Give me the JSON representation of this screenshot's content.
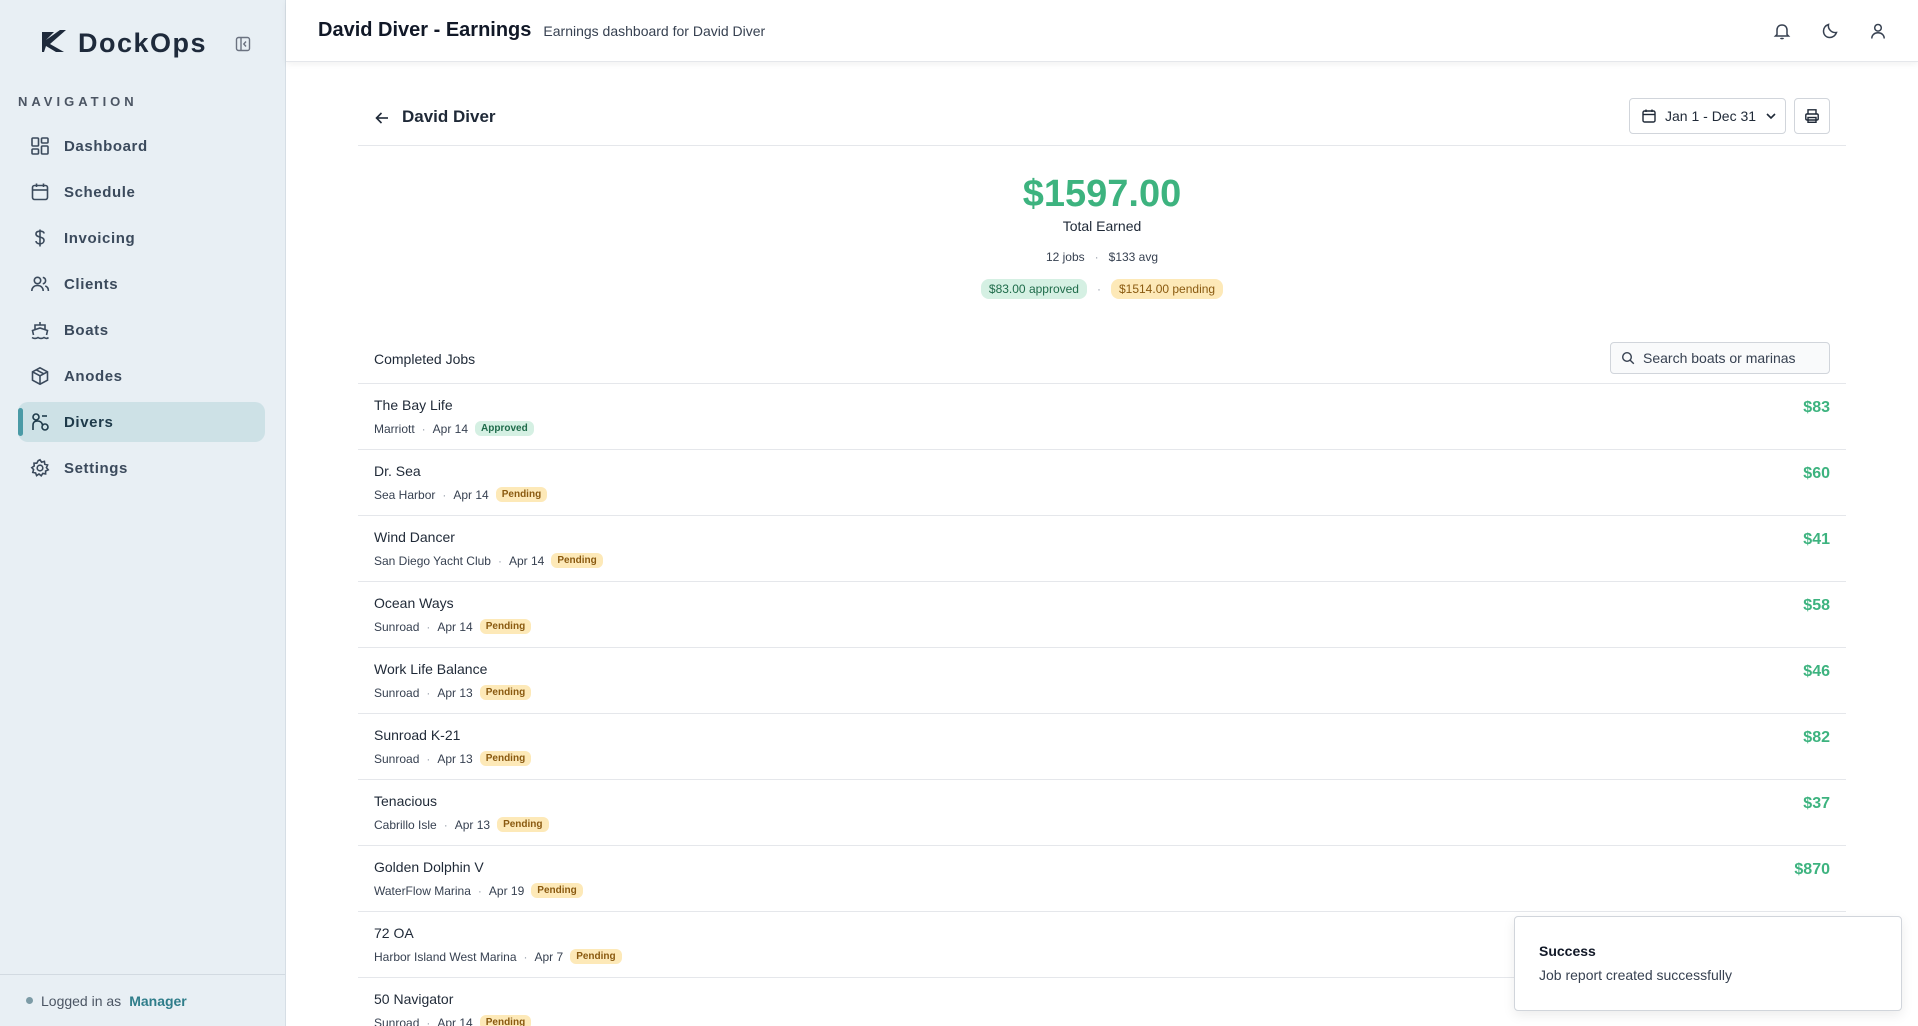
{
  "app": {
    "name": "DockOps"
  },
  "sidebar": {
    "heading": "NAVIGATION",
    "items": [
      {
        "label": "Dashboard",
        "icon": "dashboard-icon",
        "active": false
      },
      {
        "label": "Schedule",
        "icon": "calendar-icon",
        "active": false
      },
      {
        "label": "Invoicing",
        "icon": "dollar-icon",
        "active": false
      },
      {
        "label": "Clients",
        "icon": "users-icon",
        "active": false
      },
      {
        "label": "Boats",
        "icon": "ship-icon",
        "active": false
      },
      {
        "label": "Anodes",
        "icon": "package-icon",
        "active": false
      },
      {
        "label": "Divers",
        "icon": "diver-icon",
        "active": true
      },
      {
        "label": "Settings",
        "icon": "gear-icon",
        "active": false
      }
    ],
    "footer": {
      "prefix": "Logged in as",
      "role": "Manager"
    }
  },
  "header": {
    "title": "David Diver - Earnings",
    "subtitle": "Earnings dashboard for David Diver"
  },
  "page": {
    "diver_name": "David Diver",
    "date_range": "Jan 1 - Dec 31"
  },
  "summary": {
    "total": "$1597.00",
    "total_label": "Total Earned",
    "jobs": "12 jobs",
    "avg": "$133 avg",
    "approved": "$83.00 approved",
    "pending": "$1514.00 pending"
  },
  "jobs_section": {
    "title": "Completed Jobs",
    "search_placeholder": "Search boats or marinas"
  },
  "jobs": [
    {
      "boat": "The Bay Life",
      "marina": "Marriott",
      "date": "Apr 14",
      "status": "Approved",
      "amount": "$83"
    },
    {
      "boat": "Dr. Sea",
      "marina": "Sea Harbor",
      "date": "Apr 14",
      "status": "Pending",
      "amount": "$60"
    },
    {
      "boat": "Wind Dancer",
      "marina": "San Diego Yacht Club",
      "date": "Apr 14",
      "status": "Pending",
      "amount": "$41"
    },
    {
      "boat": "Ocean Ways",
      "marina": "Sunroad",
      "date": "Apr 14",
      "status": "Pending",
      "amount": "$58"
    },
    {
      "boat": "Work Life Balance",
      "marina": "Sunroad",
      "date": "Apr 13",
      "status": "Pending",
      "amount": "$46"
    },
    {
      "boat": "Sunroad K-21",
      "marina": "Sunroad",
      "date": "Apr 13",
      "status": "Pending",
      "amount": "$82"
    },
    {
      "boat": "Tenacious",
      "marina": "Cabrillo Isle",
      "date": "Apr 13",
      "status": "Pending",
      "amount": "$37"
    },
    {
      "boat": "Golden Dolphin V",
      "marina": "WaterFlow Marina",
      "date": "Apr 19",
      "status": "Pending",
      "amount": "$870"
    },
    {
      "boat": "72 OA",
      "marina": "Harbor Island West Marina",
      "date": "Apr 7",
      "status": "Pending",
      "amount": ""
    },
    {
      "boat": "50 Navigator",
      "marina": "Sunroad",
      "date": "Apr 14",
      "status": "Pending",
      "amount": ""
    }
  ],
  "toast": {
    "title": "Success",
    "message": "Job report created successfully"
  },
  "colors": {
    "accent_green": "#3db37f",
    "sidebar_bg": "#e8eff4",
    "active_nav_bg": "#cde1e6",
    "active_indicator": "#4a9aa6"
  }
}
